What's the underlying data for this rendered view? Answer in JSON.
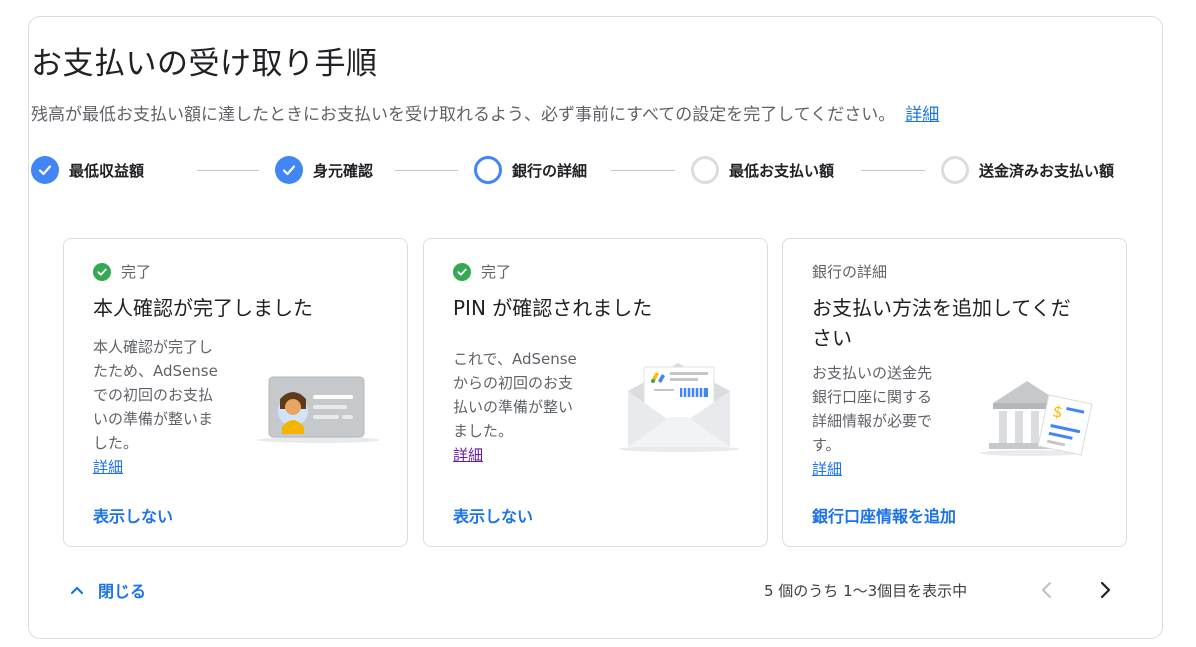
{
  "header": {
    "title": "お支払いの受け取り手順",
    "description": "残高が最低お支払い額に達したときにお支払いを受け取れるよう、必ず事前にすべての設定を完了してください。",
    "details_link": "詳細"
  },
  "steps": [
    {
      "label": "最低収益額",
      "state": "done"
    },
    {
      "label": "身元確認",
      "state": "done"
    },
    {
      "label": "銀行の詳細",
      "state": "current"
    },
    {
      "label": "最低お支払い額",
      "state": "todo"
    },
    {
      "label": "送金済みお支払い額",
      "state": "todo"
    }
  ],
  "cards": [
    {
      "status": "完了",
      "title": "本人確認が完了しました",
      "body_lines": [
        "本人確認が完了し",
        "たため、AdSense",
        "での初回のお支払",
        "いの準備が整いま",
        "した。"
      ],
      "link": "詳細",
      "action": "表示しない",
      "illustration": "id-card-icon"
    },
    {
      "status": "完了",
      "title": "PIN が確認されました",
      "body_lines": [
        "これで、AdSense",
        "からの初回のお支",
        "払いの準備が整い",
        "ました。"
      ],
      "link": "詳細",
      "action": "表示しない",
      "illustration": "envelope-icon"
    },
    {
      "status": "銀行の詳細",
      "title_lines": [
        "お支払い方法を追加してくだ",
        "さい"
      ],
      "body_lines": [
        "お支払いの送金先",
        "銀行口座に関する",
        "詳細情報が必要で",
        "す。"
      ],
      "link": "詳細",
      "action": "銀行口座情報を追加",
      "illustration": "bank-icon"
    }
  ],
  "footer": {
    "close_label": "閉じる",
    "pagination_text": "5 個のうち 1〜3個目を表示中"
  },
  "colors": {
    "accent": "#1a73e8",
    "step_done": "#4285f4",
    "success": "#34a853",
    "border": "#dadce0"
  }
}
